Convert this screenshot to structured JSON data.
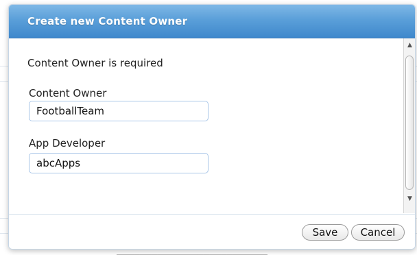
{
  "dialog": {
    "title": "Create new Content Owner",
    "validation_message": "Content Owner is required",
    "fields": [
      {
        "label": "Content Owner",
        "value": "FootballTeam"
      },
      {
        "label": "App Developer",
        "value": "abcApps"
      }
    ],
    "buttons": {
      "save": "Save",
      "cancel": "Cancel"
    }
  },
  "colors": {
    "titlebar": "#4f95d4",
    "input_border": "#a9c6e8"
  }
}
